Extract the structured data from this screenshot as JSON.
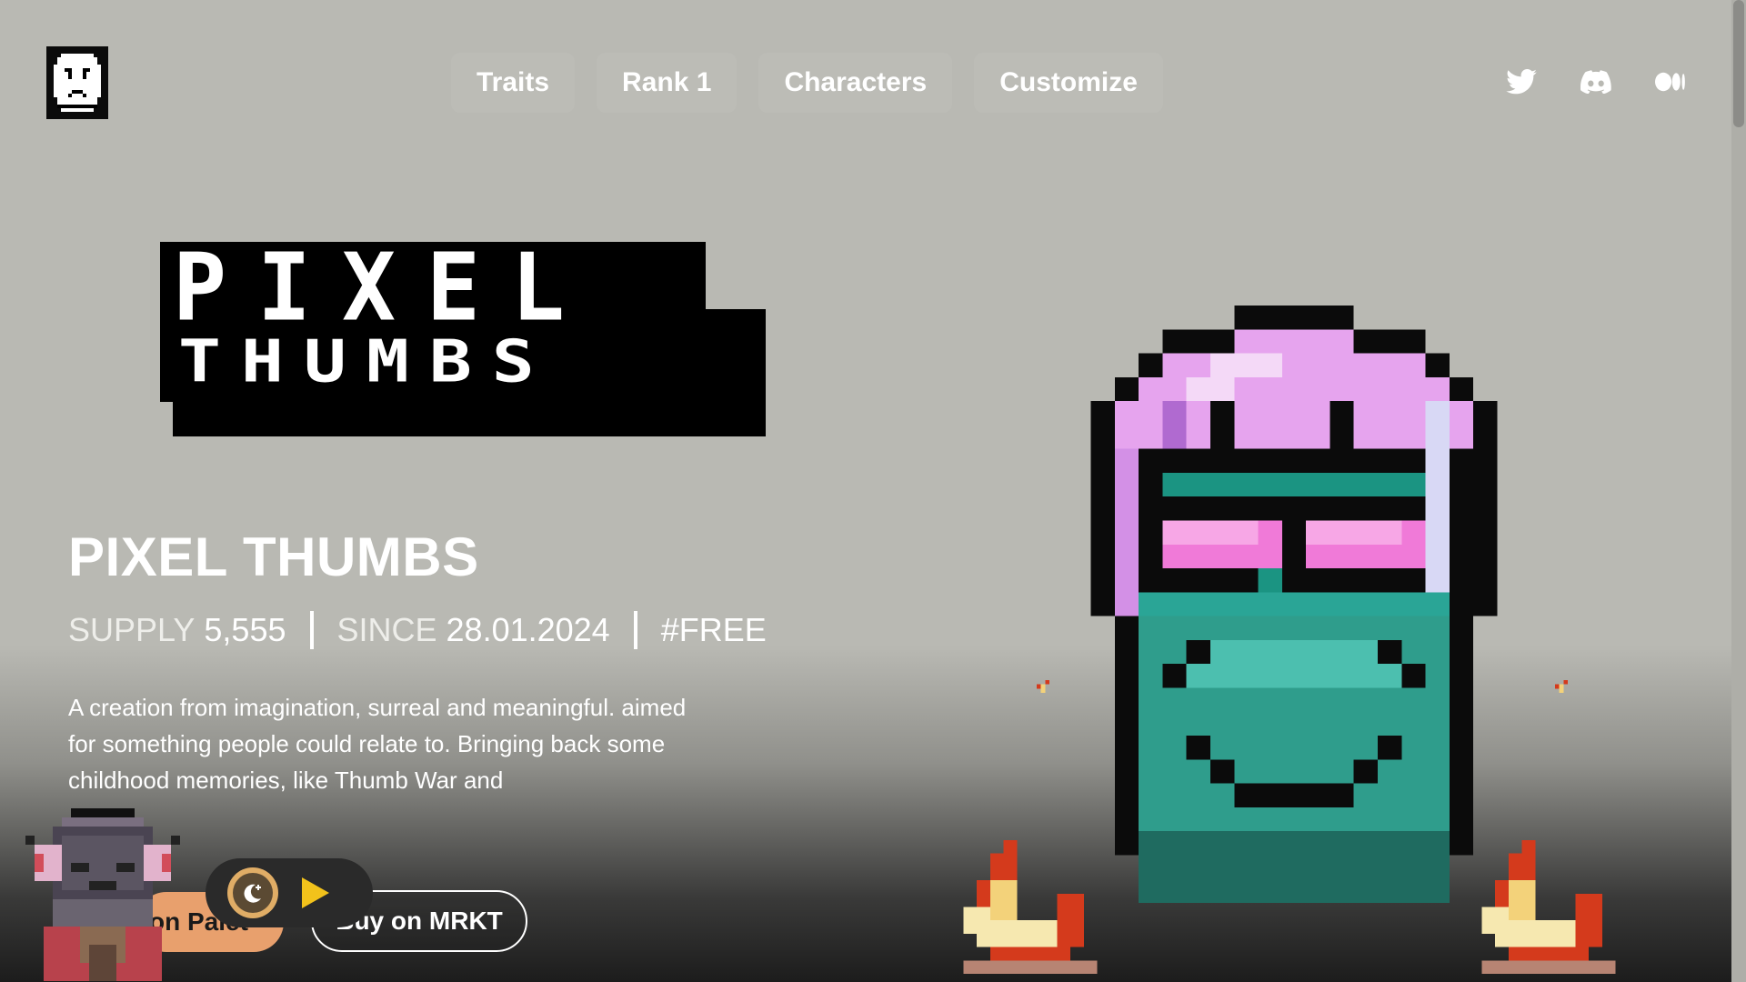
{
  "nav": {
    "items": [
      {
        "label": "Traits",
        "name": "nav-traits"
      },
      {
        "label": "Rank 1",
        "name": "nav-rank-1"
      },
      {
        "label": "Characters",
        "name": "nav-characters"
      },
      {
        "label": "Customize",
        "name": "nav-customize"
      }
    ]
  },
  "socials": [
    "twitter-icon",
    "discord-icon",
    "medium-icon"
  ],
  "hero": {
    "logo_line1": "PIXEL",
    "logo_line2": "THUMBS",
    "title": "PIXEL THUMBS",
    "supply_label": "SUPPLY",
    "supply_value": "5,555",
    "since_label": "SINCE",
    "since_value": "28.01.2024",
    "tag": "#FREE",
    "description": "A creation from imagination, surreal and meaningful. aimed for something people could relate to. Bringing back some childhood memories, like Thumb War and"
  },
  "buttons": {
    "palet": "on Palet",
    "mrkt": "Buy on MRKT"
  },
  "colors": {
    "background": "#b9b9b3",
    "accent_orange": "#e8a06d",
    "play_yellow": "#f2c21b",
    "character_teal": "#2f9d8c",
    "character_pink": "#e6a4ee"
  }
}
